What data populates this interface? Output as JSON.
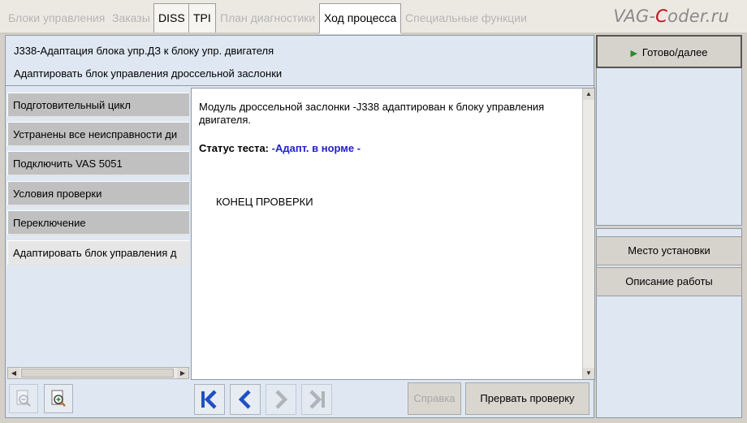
{
  "tabs": [
    {
      "label": "Блоки управления",
      "state": "disabled"
    },
    {
      "label": "Заказы",
      "state": "disabled"
    },
    {
      "label": "DISS",
      "state": "enabled"
    },
    {
      "label": "TPI",
      "state": "enabled"
    },
    {
      "label": "План диагностики",
      "state": "disabled"
    },
    {
      "label": "Ход процесса",
      "state": "active"
    },
    {
      "label": "Специальные функции",
      "state": "disabled"
    }
  ],
  "logo": {
    "part1": "VAG-",
    "part2": "C",
    "part3": "oder.ru"
  },
  "header": {
    "title": "J338-Адаптация блока упр.ДЗ к блоку упр. двигателя",
    "subtitle": "Адаптировать блок управления дроссельной заслонки"
  },
  "steps": [
    {
      "label": "Подготовительный цикл",
      "active": false
    },
    {
      "label": "Устранены все неисправности ди",
      "active": false
    },
    {
      "label": "Подключить VAS 5051",
      "active": false
    },
    {
      "label": "Условия проверки",
      "active": false
    },
    {
      "label": "Переключение",
      "active": false
    },
    {
      "label": "Адаптировать блок управления д",
      "active": true
    }
  ],
  "content": {
    "message": "Модуль дроссельной заслонки -J338 адаптирован к блоку управления двигателя.",
    "status_label": "Статус теста:",
    "status_value": "-Адапт. в норме -",
    "end_text": "КОНЕЦ ПРОВЕРКИ"
  },
  "toolbar": {
    "zoom_out_icon": "zoom-out-icon",
    "zoom_in_icon": "zoom-in-icon",
    "nav_icons": [
      "skip-to-first-icon",
      "previous-icon",
      "next-icon",
      "skip-to-last-icon"
    ],
    "help_label": "Справка",
    "abort_label": "Прервать проверку"
  },
  "right": {
    "next_label": "Готово/далее",
    "location_label": "Место установки",
    "work_label": "Описание работы"
  },
  "colors": {
    "panel_bg": "#dfe8f2",
    "status_value": "#1f1fc8",
    "nav_icon_blue": "#1e4fc4",
    "next_triangle": "#2c8a2c"
  }
}
